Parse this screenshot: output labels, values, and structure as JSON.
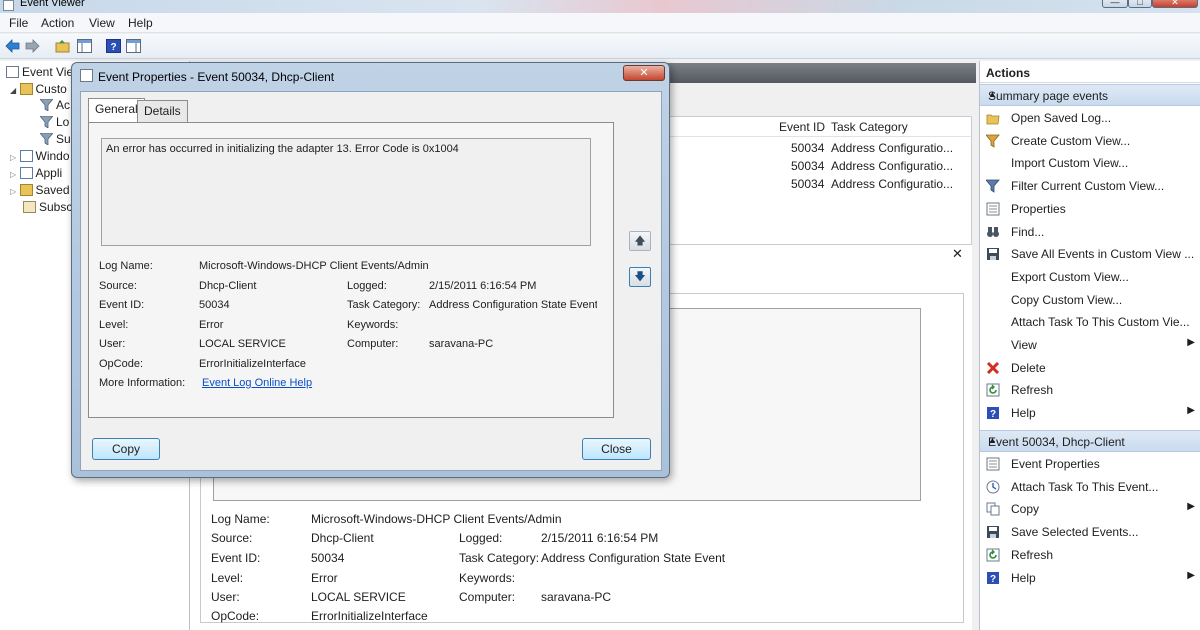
{
  "window": {
    "title": "Event Viewer",
    "controls": {
      "minimize": "—",
      "maximize": "□",
      "close": "✕"
    }
  },
  "menu": [
    "File",
    "Action",
    "View",
    "Help"
  ],
  "tree": {
    "items": [
      {
        "label": "Event Vie",
        "icon": "event-viewer-icon"
      },
      {
        "label": "Custo",
        "icon": "folder-icon"
      },
      {
        "label": "Ac",
        "icon": "filter-icon"
      },
      {
        "label": "Lo",
        "icon": "filter-icon"
      },
      {
        "label": "Su",
        "icon": "filter-icon"
      },
      {
        "label": "Windo",
        "icon": "logs-icon"
      },
      {
        "label": "Appli",
        "icon": "logs-icon"
      },
      {
        "label": "Saved",
        "icon": "folder-icon"
      },
      {
        "label": "Subsc",
        "icon": "subscriptions-icon"
      }
    ]
  },
  "grid": {
    "columns": [
      "Event ID",
      "Task Category"
    ],
    "rows": [
      {
        "event_id": "50034",
        "category": "Address Configuratio..."
      },
      {
        "event_id": "50034",
        "category": "Address Configuratio..."
      },
      {
        "event_id": "50034",
        "category": "Address Configuratio..."
      }
    ]
  },
  "details": {
    "log_name_label": "Log Name:",
    "log_name": "Microsoft-Windows-DHCP Client Events/Admin",
    "source_label": "Source:",
    "source": "Dhcp-Client",
    "logged_label": "Logged:",
    "logged": "2/15/2011 6:16:54 PM",
    "event_id_label": "Event ID:",
    "event_id": "50034",
    "task_category_label": "Task Category:",
    "task_category": "Address Configuration State Event",
    "level_label": "Level:",
    "level": "Error",
    "keywords_label": "Keywords:",
    "user_label": "User:",
    "user": "LOCAL SERVICE",
    "computer_label": "Computer:",
    "computer": "saravana-PC",
    "opcode_label": "OpCode:",
    "opcode": "ErrorInitializeInterface",
    "close_x": "✕"
  },
  "actions": {
    "header": "Actions",
    "section1": {
      "title": "Summary page events",
      "items": [
        {
          "label": "Open Saved Log...",
          "icon": "open-folder-icon"
        },
        {
          "label": "Create Custom View...",
          "icon": "filter-create-icon"
        },
        {
          "label": "Import Custom View...",
          "icon": ""
        },
        {
          "label": "Filter Current Custom View...",
          "icon": "filter-icon"
        },
        {
          "label": "Properties",
          "icon": "properties-icon"
        },
        {
          "label": "Find...",
          "icon": "binoculars-icon"
        },
        {
          "label": "Save All Events in Custom View ...",
          "icon": "save-icon"
        },
        {
          "label": "Export Custom View...",
          "icon": ""
        },
        {
          "label": "Copy Custom View...",
          "icon": ""
        },
        {
          "label": "Attach Task To This Custom Vie...",
          "icon": ""
        },
        {
          "label": "View",
          "icon": "",
          "submenu": true
        },
        {
          "label": "Delete",
          "icon": "delete-icon"
        },
        {
          "label": "Refresh",
          "icon": "refresh-icon"
        },
        {
          "label": "Help",
          "icon": "help-icon",
          "submenu": true
        }
      ]
    },
    "section2": {
      "title": "Event 50034, Dhcp-Client",
      "items": [
        {
          "label": "Event Properties",
          "icon": "properties-icon"
        },
        {
          "label": "Attach Task To This Event...",
          "icon": "task-icon"
        },
        {
          "label": "Copy",
          "icon": "copy-icon",
          "submenu": true
        },
        {
          "label": "Save Selected Events...",
          "icon": "save-icon"
        },
        {
          "label": "Refresh",
          "icon": "refresh-icon"
        },
        {
          "label": "Help",
          "icon": "help-icon",
          "submenu": true
        }
      ]
    }
  },
  "dialog": {
    "title": "Event Properties - Event 50034, Dhcp-Client",
    "close": "✕",
    "tabs": [
      "General",
      "Details"
    ],
    "message": "An error has occurred in initializing the adapter 13. Error Code is 0x1004",
    "log_name_label": "Log Name:",
    "log_name": "Microsoft-Windows-DHCP Client Events/Admin",
    "source_label": "Source:",
    "source": "Dhcp-Client",
    "logged_label": "Logged:",
    "logged": "2/15/2011 6:16:54 PM",
    "event_id_label": "Event ID:",
    "event_id": "50034",
    "task_category_label": "Task Category:",
    "task_category": "Address Configuration State Event",
    "level_label": "Level:",
    "level": "Error",
    "keywords_label": "Keywords:",
    "user_label": "User:",
    "user": "LOCAL SERVICE",
    "computer_label": "Computer:",
    "computer": "saravana-PC",
    "opcode_label": "OpCode:",
    "opcode": "ErrorInitializeInterface",
    "more_info_label": "More Information:",
    "more_info_link": "Event Log Online Help",
    "copy_button": "Copy",
    "close_button": "Close",
    "up_arrow": "🡅",
    "down_arrow": "🡇"
  },
  "colors": {
    "accent": "#c9dbef",
    "link": "#0b4fc8",
    "delete": "#d42b1e",
    "help": "#2b4fb5"
  }
}
